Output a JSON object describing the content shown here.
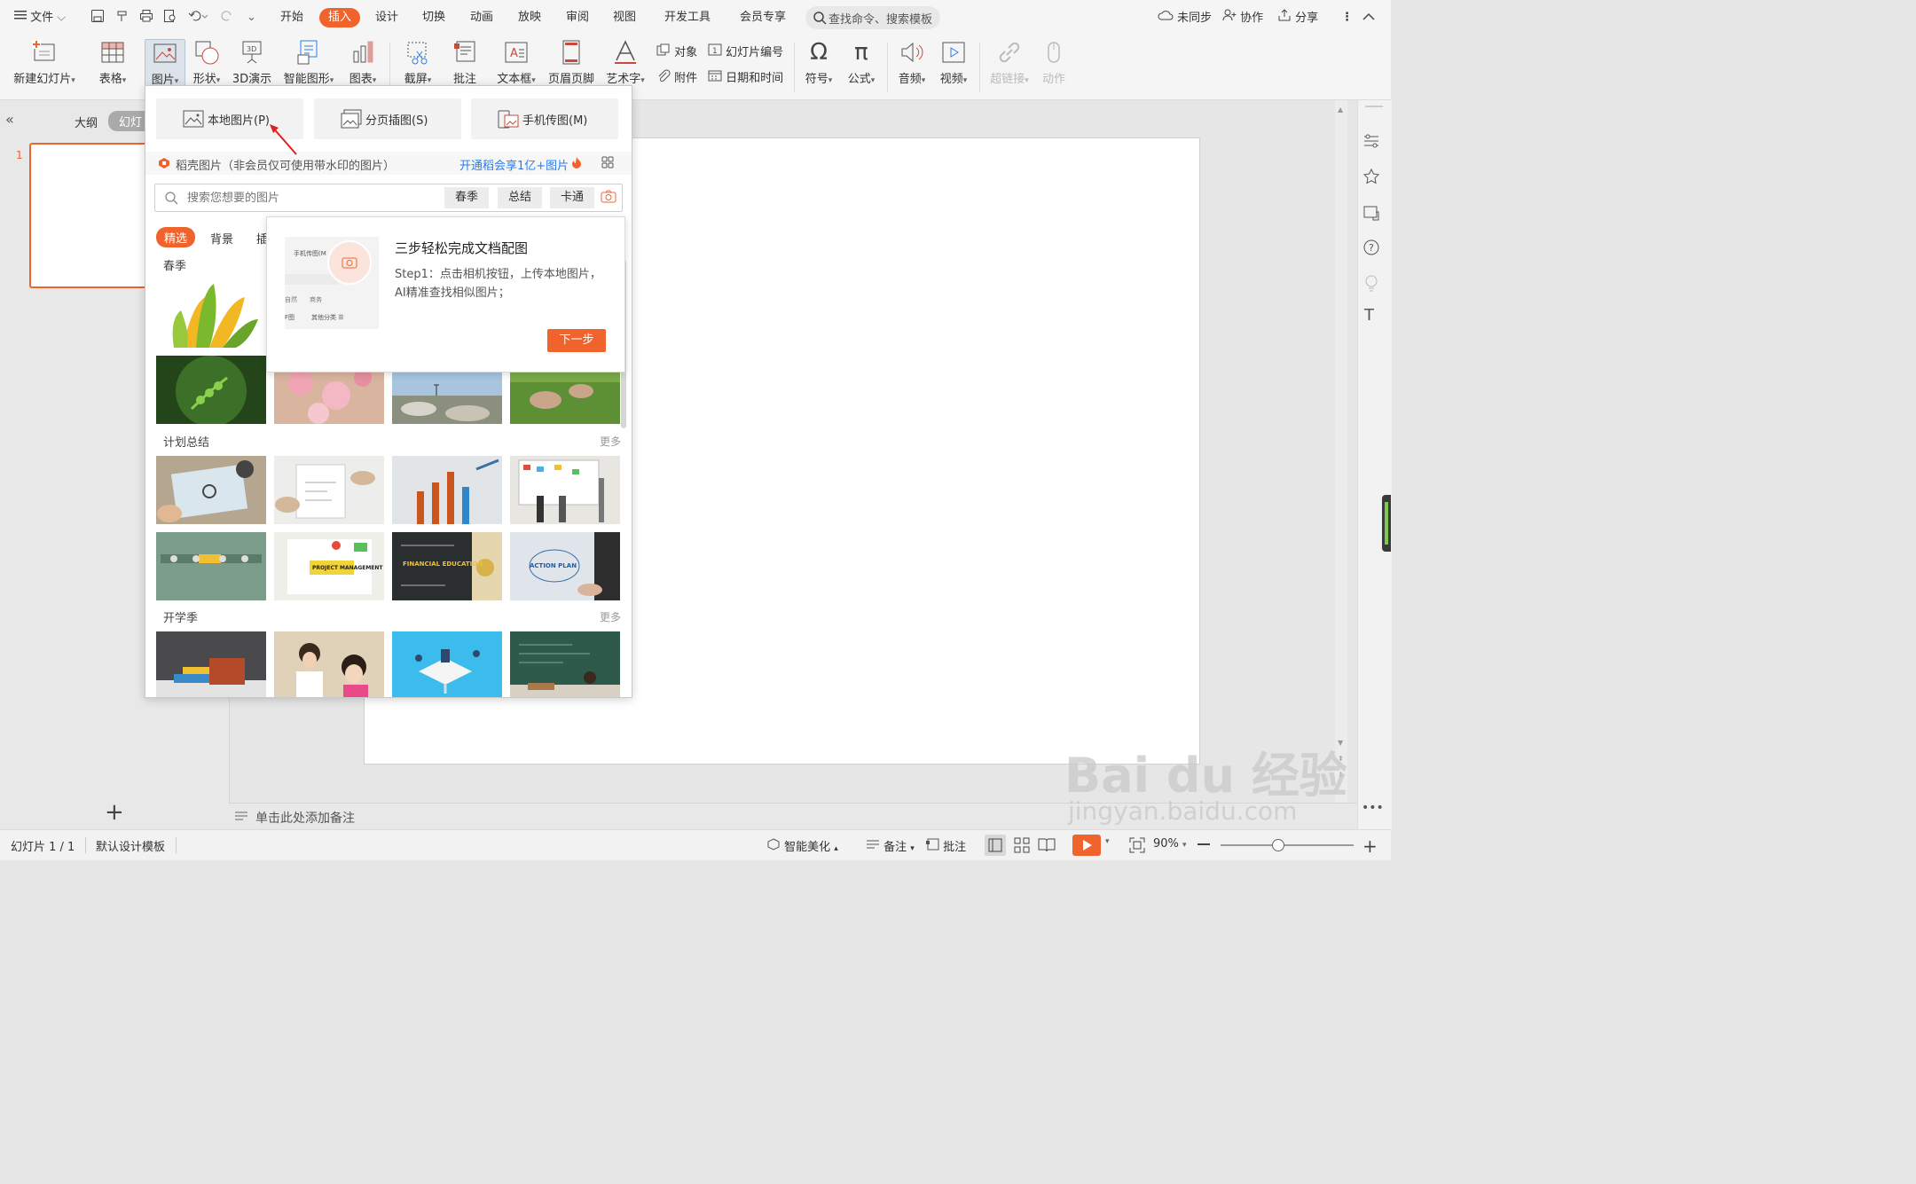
{
  "topbar": {
    "file_menu": "文件",
    "tabs": [
      "开始",
      "插入",
      "设计",
      "切换",
      "动画",
      "放映",
      "审阅",
      "视图",
      "开发工具",
      "会员专享"
    ],
    "active_tab": "插入",
    "search_placeholder": "查找命令、搜索模板",
    "sync": "未同步",
    "collab": "协作",
    "share": "分享"
  },
  "ribbon": {
    "new_slide": "新建幻灯片",
    "table": "表格",
    "picture": "图片",
    "shape": "形状",
    "3d": "3D演示",
    "smartart": "智能图形",
    "chart": "图表",
    "screenshot": "截屏",
    "comment": "批注",
    "textbox": "文本框",
    "header_footer": "页眉页脚",
    "wordart": "艺术字",
    "object": "对象",
    "slide_number": "幻灯片编号",
    "attachment": "附件",
    "datetime": "日期和时间",
    "symbol": "符号",
    "formula": "公式",
    "audio": "音频",
    "video": "视频",
    "hyperlink": "超链接",
    "action": "动作"
  },
  "leftpanel": {
    "outline_tab": "大纲",
    "slides_tab": "幻灯",
    "slide_number": "1",
    "add_symbol": "+"
  },
  "popup": {
    "local_picture": "本地图片(P)",
    "page_insert": "分页插图(S)",
    "phone_transfer": "手机传图(M)",
    "source_text": "稻壳图片（非会员仅可使用带水印的图片）",
    "promo_link": "开通稻会享1亿+图片",
    "search_placeholder": "搜索您想要的图片",
    "keywords": [
      "春季",
      "总结",
      "卡通"
    ],
    "filter_tabs": [
      "精选",
      "背景",
      "插"
    ],
    "section1": "春季",
    "section2": "计划总结",
    "section3": "开学季",
    "more": "更多",
    "thumb_texts": {
      "project": "PROJECT MANAGEMENT",
      "financial": "FINANCIAL EDUCATION",
      "action": "ACTION PLAN"
    }
  },
  "tip": {
    "title": "三步轻松完成文档配图",
    "body": "Step1：点击相机按钮，上传本地图片，AI精准查找相似图片；",
    "next": "下一步",
    "mock_title": "手机传图(M",
    "mock_chip1": "自然",
    "mock_chip2": "商务",
    "mock_left": "F图",
    "mock_right": "其他分类 ☰"
  },
  "notes": {
    "placeholder": "单击此处添加备注"
  },
  "status": {
    "slide_info": "幻灯片 1 / 1",
    "template": "默认设计模板",
    "beautify": "智能美化",
    "notes": "备注",
    "comments": "批注",
    "zoom": "90%"
  },
  "watermark": {
    "line1": "Bai du 经验",
    "line2": "jingyan.baidu.com"
  },
  "colors": {
    "accent": "#f0632c",
    "link": "#2b7de9"
  }
}
